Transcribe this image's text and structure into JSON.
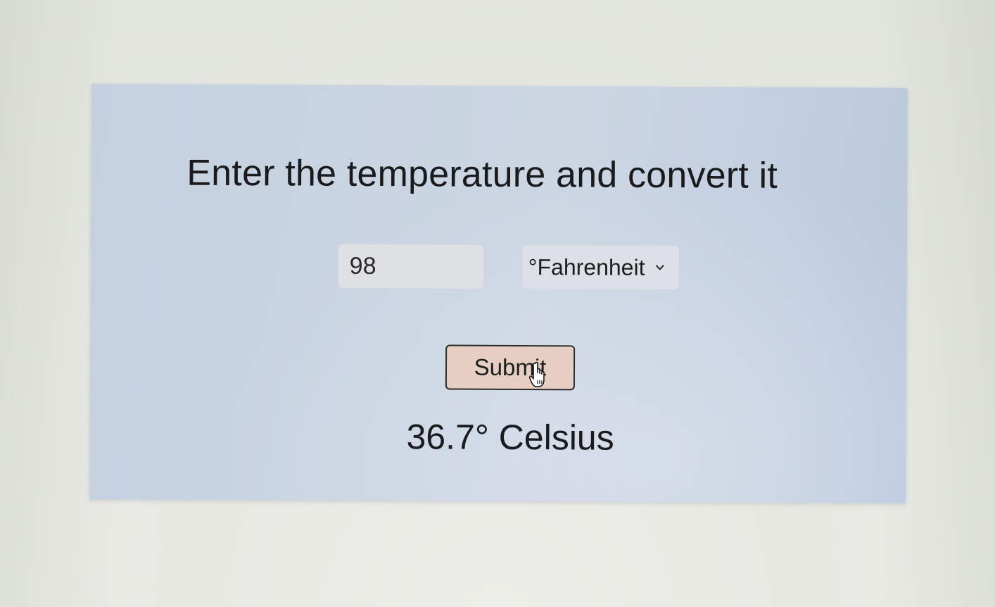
{
  "page": {
    "heading": "Enter the temperature and convert it"
  },
  "form": {
    "temperature_value": "98",
    "unit_selected": "°Fahrenheit",
    "submit_label": "Submit"
  },
  "result": {
    "text": "36.7° Celsius"
  },
  "icons": {
    "dropdown": "chevron-down-icon",
    "cursor": "hand-pointer-icon"
  },
  "colors": {
    "panel_background": "#c9d4e2",
    "input_background": "#dfe0e4",
    "button_background": "#e6cfc2",
    "button_border": "#2c2c2c",
    "text": "#1a1a1c"
  }
}
